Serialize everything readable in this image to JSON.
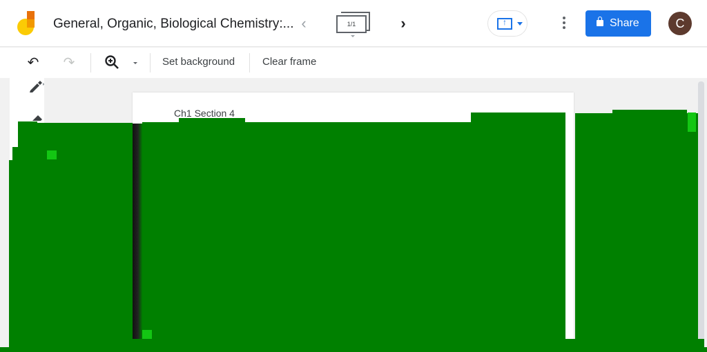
{
  "app": {
    "title": "General, Organic, Biological Chemistry:...",
    "logo": "jamboard-logo-icon"
  },
  "header": {
    "prev_icon": "chevron-left-icon",
    "prev_glyph": "‹",
    "frame_counter": "1/1",
    "next_icon": "chevron-right-icon",
    "next_glyph": "›",
    "cast_icon": "present-to-device-icon",
    "more_icon": "more-vert-icon",
    "share_label": "Share",
    "share_icon": "lock-icon",
    "avatar_letter": "C",
    "colors": {
      "accent": "#1a73e8",
      "avatar": "#5d3a2e"
    }
  },
  "toolbar": {
    "undo_glyph": "↶",
    "redo_glyph": "↷",
    "zoom_icon": "zoom-in-icon",
    "set_background_label": "Set background",
    "clear_frame_label": "Clear frame"
  },
  "canvas": {
    "frame_title": "Ch1 Section 4",
    "overlay_color": "#008000",
    "side_tools": [
      "pen-icon",
      "eraser-icon"
    ]
  }
}
